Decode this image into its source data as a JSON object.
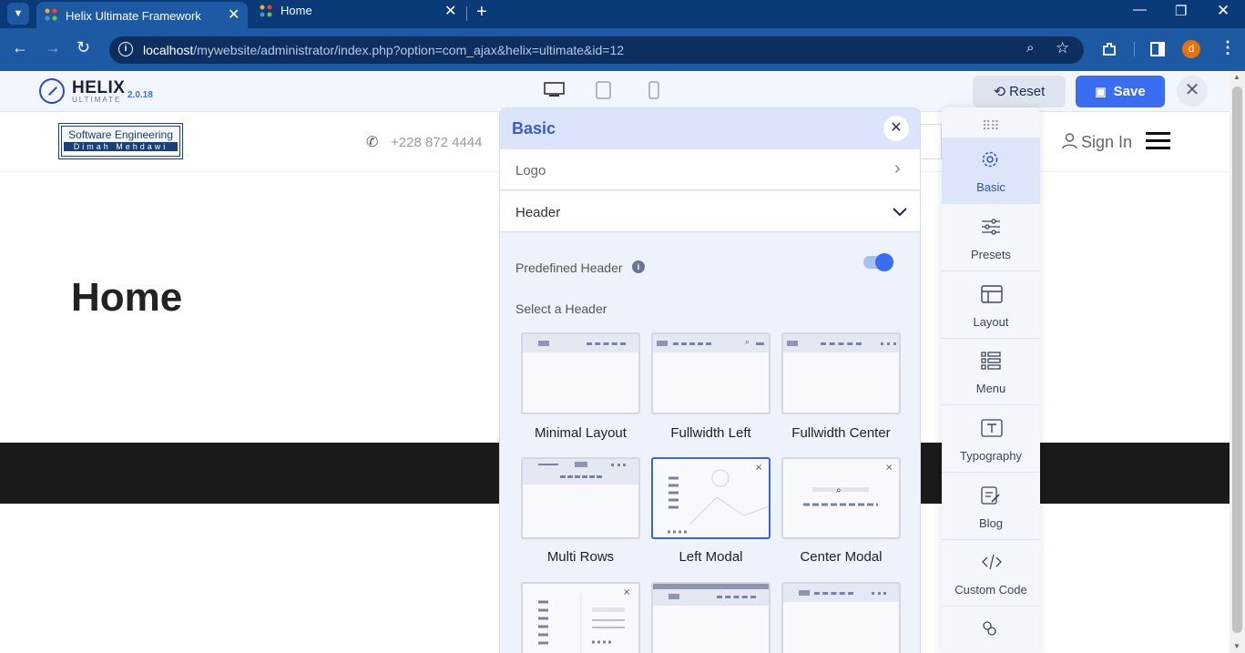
{
  "browser": {
    "tabs": [
      {
        "title": "Helix Ultimate Framework",
        "active": true
      },
      {
        "title": "Home",
        "active": false
      }
    ],
    "url_host": "localhost",
    "url_path": "/mywebsite/administrator/index.php?option=com_ajax&helix=ultimate&id=12",
    "profile_initial": "d"
  },
  "toolbar": {
    "logo_text": "HELIX",
    "logo_sub": "ULTIMATE",
    "version": "2.0.18",
    "reset_label": "Reset",
    "save_label": "Save"
  },
  "site": {
    "logo_line1": "Software Engineering",
    "logo_line2": "Dimah Mehdawi",
    "phone": "+228 872 4444",
    "signin": "Sign In",
    "page_title": "Home"
  },
  "panel": {
    "title": "Basic",
    "sections": [
      {
        "label": "Logo",
        "expanded": false
      },
      {
        "label": "Header",
        "expanded": true
      }
    ],
    "predefined_header_label": "Predefined Header",
    "predefined_header_on": true,
    "select_header_label": "Select a Header",
    "headers": [
      {
        "label": "Minimal Layout"
      },
      {
        "label": "Fullwidth Left"
      },
      {
        "label": "Fullwidth Center"
      },
      {
        "label": "Multi Rows"
      },
      {
        "label": "Left Modal",
        "selected": true
      },
      {
        "label": "Center Modal"
      }
    ]
  },
  "sidebar": {
    "items": [
      {
        "label": "Basic",
        "icon": "gear-icon",
        "active": true
      },
      {
        "label": "Presets",
        "icon": "sliders-icon"
      },
      {
        "label": "Layout",
        "icon": "layout-icon"
      },
      {
        "label": "Menu",
        "icon": "menu-icon"
      },
      {
        "label": "Typography",
        "icon": "typography-icon"
      },
      {
        "label": "Blog",
        "icon": "blog-icon"
      },
      {
        "label": "Custom Code",
        "icon": "code-icon"
      }
    ]
  },
  "colors": {
    "accent": "#3b6df0",
    "chrome": "#0b3a78",
    "urlbar": "#1e5aa4",
    "dark_band": "#1a1a1a"
  }
}
